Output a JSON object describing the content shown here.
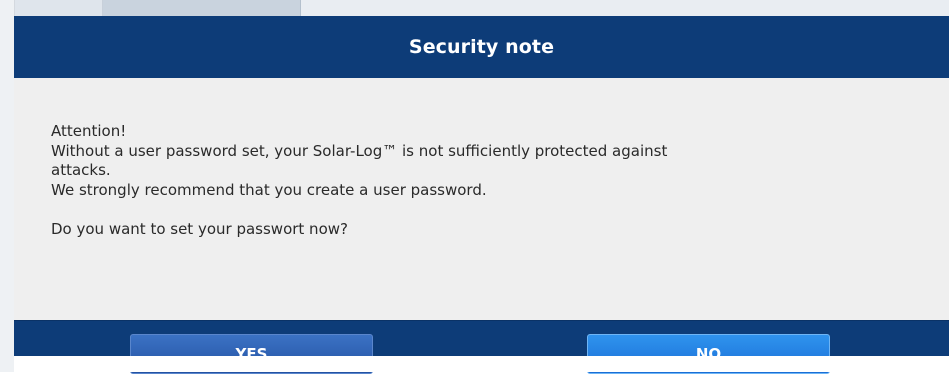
{
  "dialog": {
    "title": "Security note",
    "lines": [
      "Attention!",
      "Without a user password set, your Solar-Log™ is not sufficiently protected against",
      "attacks.",
      "We strongly recommend that you create a user password.",
      "",
      "Do you want to set your passwort now?"
    ],
    "buttons": {
      "yes_label": "YES",
      "no_label": "NO"
    }
  },
  "colors": {
    "header_bg": "#0d3c78",
    "body_bg": "#efefef",
    "yes_button": "#2452a3",
    "no_button": "#1a6fd6"
  }
}
